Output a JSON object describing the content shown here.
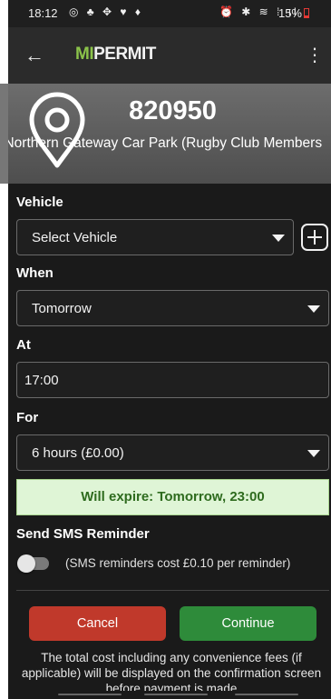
{
  "status_bar": {
    "time": "18:12",
    "left_icons": "◎ ♣ ✥ ♥ ♦",
    "right_icons": "⏰ ✱ ≋ ⁞ ıl",
    "battery": "15%"
  },
  "app_bar": {
    "back_icon": "arrow-left-icon",
    "logo_mi": "MI",
    "logo_permit": "PERMIT",
    "menu_icon": "more-vertical-icon"
  },
  "location": {
    "code": "820950",
    "name": ") Northern Gateway Car Park (Rugby Club Members"
  },
  "form": {
    "vehicle": {
      "label": "Vehicle",
      "value": "Select Vehicle"
    },
    "when": {
      "label": "When",
      "value": "Tomorrow"
    },
    "at": {
      "label": "At",
      "value": "17:00"
    },
    "for": {
      "label": "For",
      "value": "6 hours (£0.00)"
    },
    "expiry": "Will expire: Tomorrow, 23:00",
    "sms": {
      "label": "Send SMS Reminder",
      "enabled": false,
      "note": "(SMS reminders cost £0.10 per reminder)"
    }
  },
  "actions": {
    "cancel": "Cancel",
    "continue": "Continue"
  },
  "footnote": "The total cost including any convenience fees (if applicable) will be displayed on the confirmation screen before payment is made",
  "colors": {
    "brand_green": "#8bc34a",
    "cancel_red": "#c0392b",
    "continue_green": "#2e8b3a",
    "expiry_bg": "#dff5d6"
  }
}
